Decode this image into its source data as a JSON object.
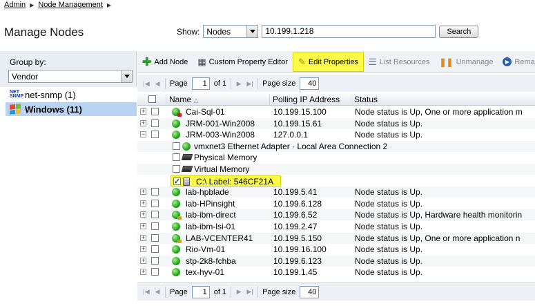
{
  "breadcrumb": {
    "items": [
      "Admin",
      "Node Management"
    ]
  },
  "page": {
    "title": "Manage Nodes"
  },
  "search": {
    "show_label": "Show:",
    "show_value": "Nodes",
    "query": "10.199.1.218",
    "button": "Search"
  },
  "left": {
    "group_by_label": "Group by:",
    "group_by_value": "Vendor",
    "groups": [
      {
        "label": "net-snmp (1)",
        "icon": "net-snmp-icon",
        "selected": false
      },
      {
        "label": "Windows (11)",
        "icon": "windows-icon",
        "selected": true
      }
    ],
    "netsnmp_logo": "NET SNMP"
  },
  "toolbar": {
    "add_node": "Add Node",
    "custom_property_editor": "Custom Property Editor",
    "edit_properties": "Edit Properties",
    "list_resources": "List Resources",
    "unmanage": "Unmanage",
    "remanage": "Rema"
  },
  "pager": {
    "page_label": "Page",
    "page_value": "1",
    "of_label": "of 1",
    "size_label": "Page size",
    "size_value": "40"
  },
  "grid": {
    "columns": [
      "Name",
      "Polling IP Address",
      "Status"
    ],
    "rows": [
      {
        "name": "Cai-Sql-01",
        "ip": "10.199.15.100",
        "status": "Node status is Up, One or more application m",
        "badge": "red"
      },
      {
        "name": "JRM-001-Win2008",
        "ip": "10.199.15.61",
        "status": "Node status is Up.",
        "badge": ""
      },
      {
        "name": "JRM-003-Win2008",
        "ip": "127.0.0.1",
        "status": "Node status is Up.",
        "badge": "",
        "expanded": true
      },
      {
        "child": true,
        "name": "vmxnet3 Ethernet Adapter · Local Area Connection 2",
        "icon": "interface"
      },
      {
        "child": true,
        "name": "Physical Memory",
        "icon": "memory"
      },
      {
        "child": true,
        "name": "Virtual Memory",
        "icon": "memory"
      },
      {
        "child": true,
        "name": "C:\\ Label: 546CF21A",
        "icon": "disk",
        "checked": true,
        "highlight": true
      },
      {
        "name": "lab-hpblade",
        "ip": "10.199.5.41",
        "status": "Node status is Up.",
        "badge": ""
      },
      {
        "name": "lab-HPinsight",
        "ip": "10.199.6.128",
        "status": "Node status is Up.",
        "badge": ""
      },
      {
        "name": "lab-ibm-direct",
        "ip": "10.199.6.52",
        "status": "Node status is Up, Hardware health monitorin",
        "badge": "warn"
      },
      {
        "name": "lab-ibm-lsi-01",
        "ip": "10.199.2.47",
        "status": "Node status is Up.",
        "badge": ""
      },
      {
        "name": "LAB-VCENTER41",
        "ip": "10.199.5.150",
        "status": "Node status is Up, One or more application n",
        "badge": "warn"
      },
      {
        "name": "Rio-Vm-01",
        "ip": "10.199.16.100",
        "status": "Node status is Up.",
        "badge": ""
      },
      {
        "name": "stp-2k8-fchba",
        "ip": "10.199.6.123",
        "status": "Node status is Up.",
        "badge": ""
      },
      {
        "name": "tex-hyv-01",
        "ip": "10.199.1.45",
        "status": "Node status is Up.",
        "badge": ""
      }
    ]
  },
  "colors": {
    "highlight": "#fbf94a",
    "selected_group": "#b9d3f0",
    "toolbar_bg": "#eef1f5"
  }
}
